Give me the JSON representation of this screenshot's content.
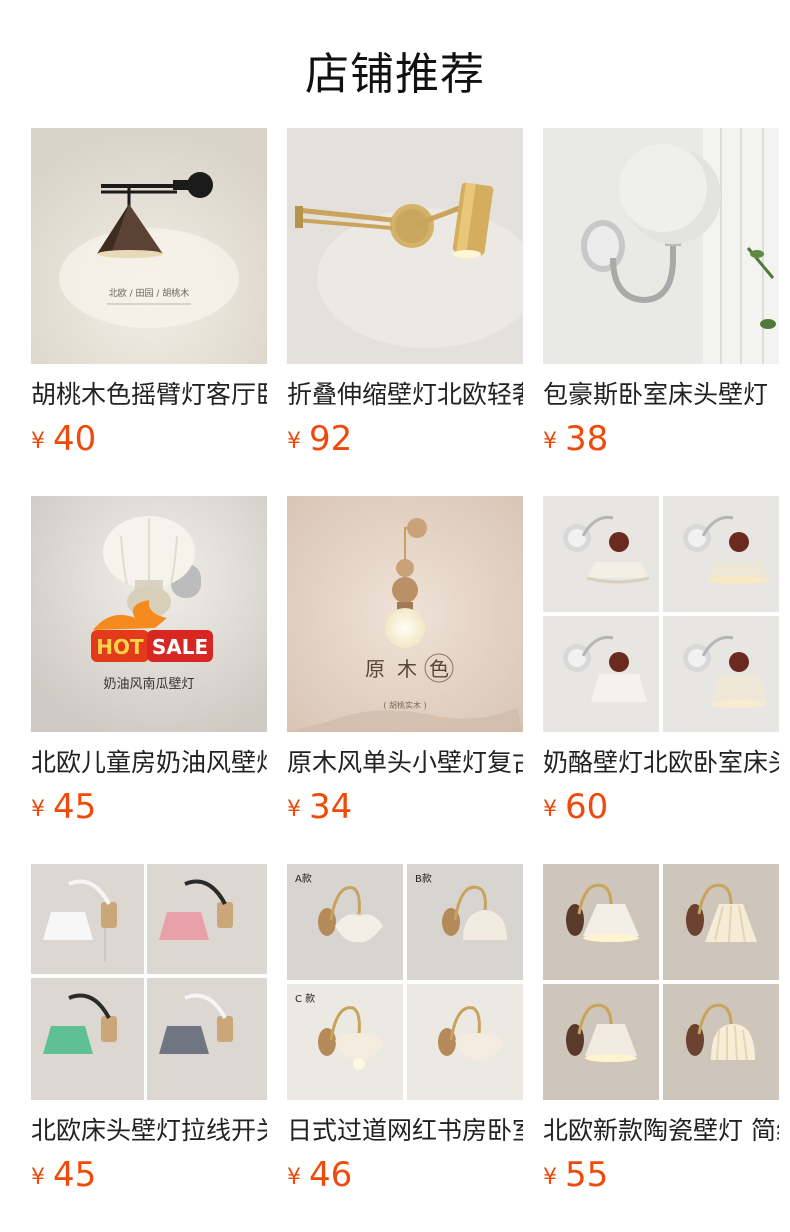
{
  "section": {
    "title": "店铺推荐"
  },
  "currency_symbol": "¥",
  "accent_color": "#ef4a0c",
  "products": [
    {
      "name": "胡桃木色摇臂灯客厅卧室",
      "price": "40",
      "image_icon": "walnut-swing-arm-wall-lamp-image",
      "image_caption": "北欧 / 田园 / 胡桃木"
    },
    {
      "name": "折叠伸缩壁灯北欧轻奢",
      "price": "92",
      "image_icon": "gold-folding-arm-wall-lamp-image"
    },
    {
      "name": "包豪斯卧室床头壁灯",
      "price": "38",
      "image_icon": "bauhaus-globe-wall-lamp-image"
    },
    {
      "name": "北欧儿童房奶油风壁灯",
      "price": "45",
      "image_icon": "cream-pumpkin-wall-lamp-image",
      "image_caption": "奶油风南瓜壁灯",
      "badge_hot": "HOT",
      "badge_sale": "SALE"
    },
    {
      "name": "原木风单头小壁灯复古",
      "price": "34",
      "image_icon": "log-style-bulb-wall-lamp-image",
      "image_caption_1": "原",
      "image_caption_2": "木",
      "image_caption_3": "色",
      "image_caption_sub": "( 胡桃实木 )"
    },
    {
      "name": "奶酪壁灯北欧卧室床头",
      "price": "60",
      "image_icon": "cheese-shade-wall-lamp-grid-image"
    },
    {
      "name": "北欧床头壁灯拉线开关",
      "price": "45",
      "image_icon": "colorful-pull-cord-wall-lamp-grid-image"
    },
    {
      "name": "日式过道网红书房卧室",
      "price": "46",
      "image_icon": "japanese-style-wall-lamp-grid-image",
      "image_label_a": "A款",
      "image_label_b": "B款",
      "image_label_c": "C 款"
    },
    {
      "name": "北欧新款陶瓷壁灯 简约",
      "price": "55",
      "image_icon": "ceramic-wall-lamp-grid-image"
    }
  ]
}
